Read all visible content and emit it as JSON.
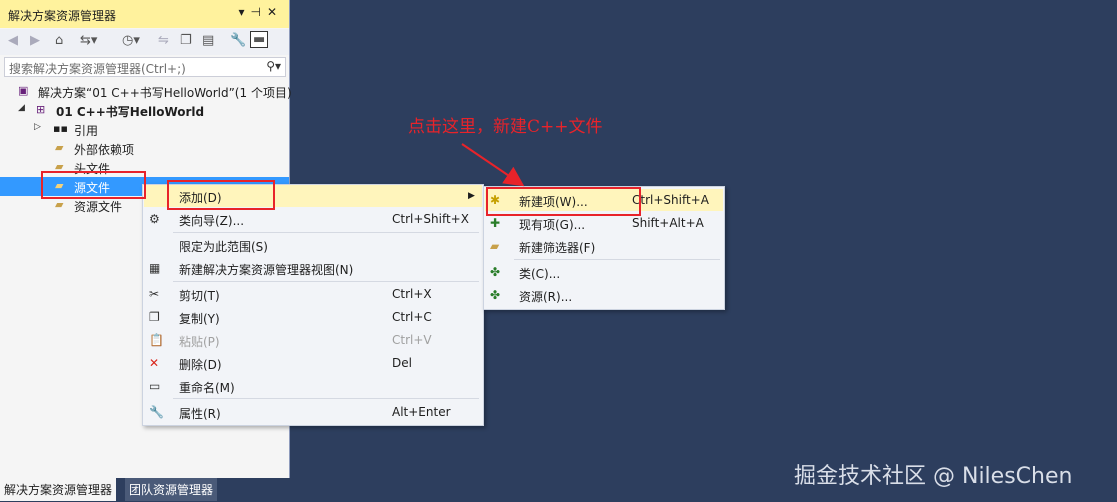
{
  "panel": {
    "title": "解决方案资源管理器",
    "title_buttons": [
      "▾",
      "⊣",
      "✕"
    ],
    "search_placeholder": "搜索解决方案资源管理器(Ctrl+;)"
  },
  "toolbar_icons": [
    "back-icon",
    "forward-icon",
    "home-icon",
    "sync-icon",
    "history-icon",
    "switch-icon",
    "collapse-icon",
    "show-all-icon",
    "properties-wrench-icon",
    "preview-icon"
  ],
  "tree": {
    "solution": "解决方案“01 C++书写HelloWorld”(1 个项目)",
    "project": "01 C++书写HelloWorld",
    "items": [
      "引用",
      "外部依赖项",
      "头文件",
      "源文件",
      "资源文件"
    ]
  },
  "bottom_tabs": [
    "解决方案资源管理器",
    "团队资源管理器"
  ],
  "context_menu": {
    "items": [
      {
        "icon": "",
        "label": "添加(D)",
        "shortcut": "",
        "submenu": true
      },
      {
        "icon": "class-wizard-icon",
        "label": "类向导(Z)...",
        "shortcut": "Ctrl+Shift+X"
      },
      {
        "icon": "",
        "label": "限定为此范围(S)",
        "shortcut": ""
      },
      {
        "icon": "new-view-icon",
        "label": "新建解决方案资源管理器视图(N)",
        "shortcut": ""
      },
      {
        "icon": "cut-icon",
        "label": "剪切(T)",
        "shortcut": "Ctrl+X"
      },
      {
        "icon": "copy-icon",
        "label": "复制(Y)",
        "shortcut": "Ctrl+C"
      },
      {
        "icon": "paste-icon",
        "label": "粘贴(P)",
        "shortcut": "Ctrl+V"
      },
      {
        "icon": "delete-icon",
        "label": "删除(D)",
        "shortcut": "Del"
      },
      {
        "icon": "rename-icon",
        "label": "重命名(M)",
        "shortcut": ""
      },
      {
        "icon": "wrench-icon",
        "label": "属性(R)",
        "shortcut": "Alt+Enter"
      }
    ]
  },
  "submenu": {
    "items": [
      {
        "label": "新建项(W)...",
        "shortcut": "Ctrl+Shift+A"
      },
      {
        "label": "现有项(G)...",
        "shortcut": "Shift+Alt+A"
      },
      {
        "label": "新建筛选器(F)",
        "shortcut": ""
      },
      {
        "label": "类(C)...",
        "shortcut": ""
      },
      {
        "label": "资源(R)...",
        "shortcut": ""
      }
    ]
  },
  "annotation": "点击这里，新建C++文件",
  "watermark": "掘金技术社区 @ NilesChen",
  "colors": {
    "background": "#2d3e5e",
    "highlight": "#fff5bc",
    "selection": "#3399ff",
    "annotation_red": "#e8232a"
  }
}
